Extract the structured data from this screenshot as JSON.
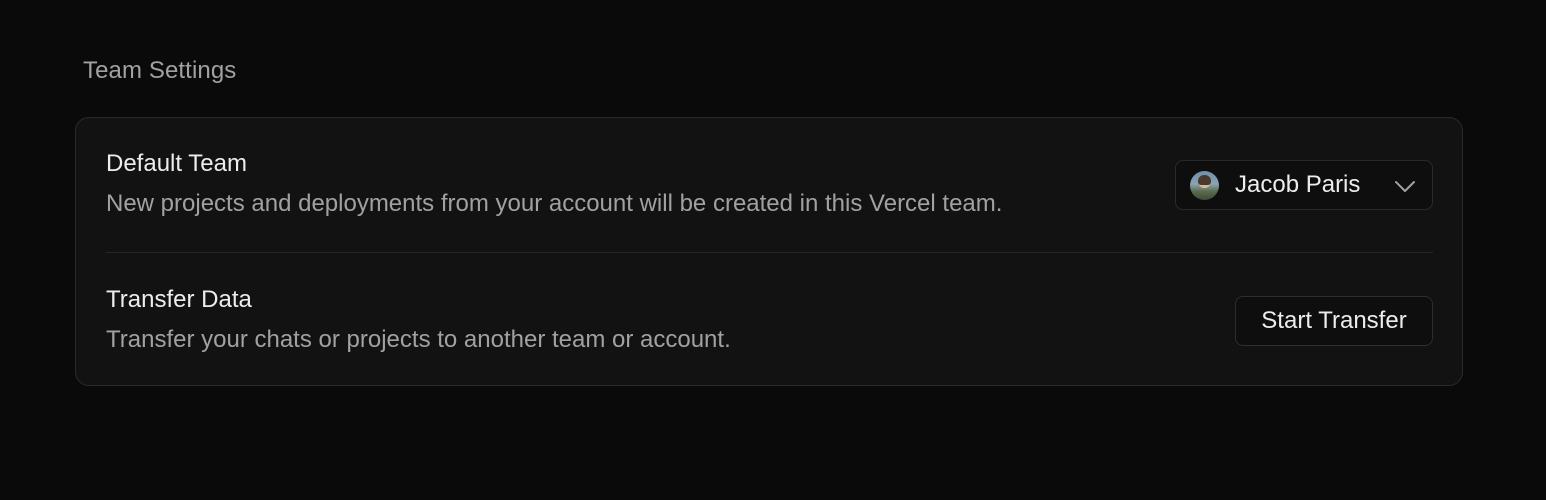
{
  "section": {
    "title": "Team Settings"
  },
  "default_team": {
    "title": "Default Team",
    "description": "New projects and deployments from your account will be created in this Vercel team.",
    "selected_team": "Jacob Paris",
    "icon": "chevron-down-icon"
  },
  "transfer_data": {
    "title": "Transfer Data",
    "description": "Transfer your chats or projects to another team or account.",
    "button_label": "Start Transfer"
  },
  "colors": {
    "background": "#0a0a0a",
    "card": "#121212",
    "border": "#2a2a2a",
    "text_primary": "#ededed",
    "text_secondary": "#a1a1a1"
  }
}
